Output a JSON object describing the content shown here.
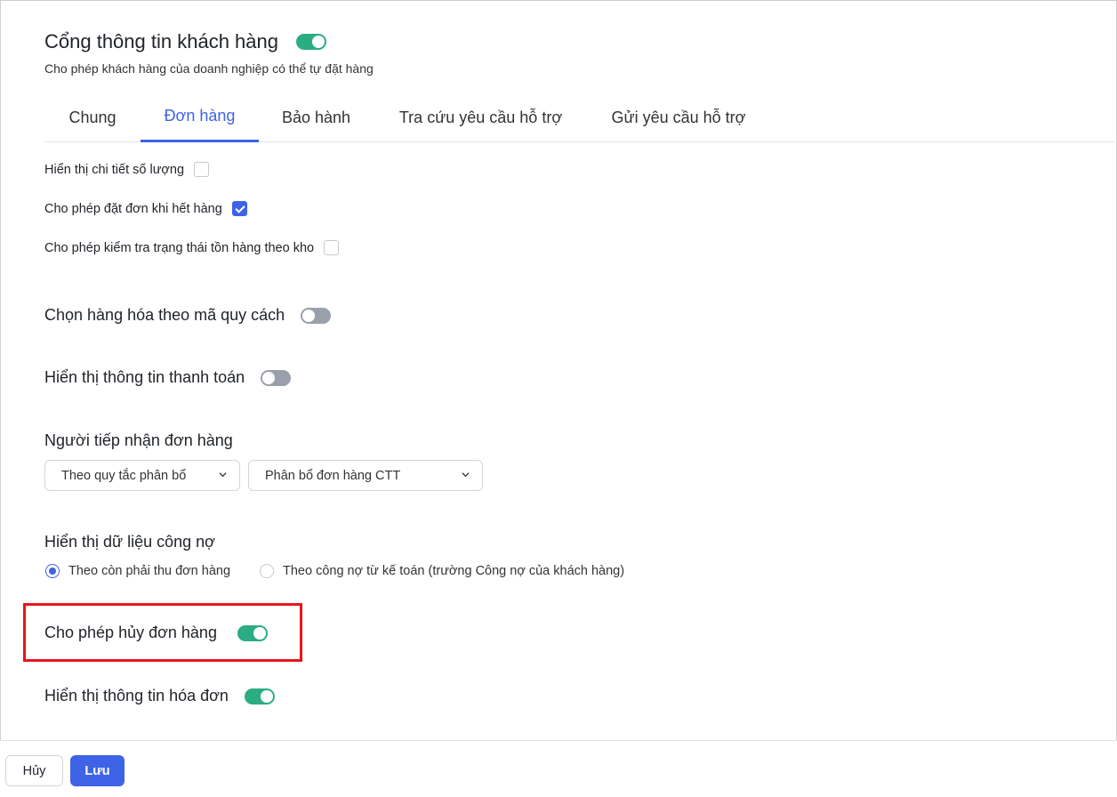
{
  "header": {
    "title": "Cổng thông tin khách hàng",
    "subtitle": "Cho phép khách hàng của doanh nghiệp có thể tự đặt hàng",
    "enabled": true
  },
  "tabs": [
    {
      "label": "Chung",
      "active": false
    },
    {
      "label": "Đơn hàng",
      "active": true
    },
    {
      "label": "Bảo hành",
      "active": false
    },
    {
      "label": "Tra cứu yêu cầu hỗ trợ",
      "active": false
    },
    {
      "label": "Gửi yêu cầu hỗ trợ",
      "active": false
    }
  ],
  "checkboxes": [
    {
      "label": "Hiển thị chi tiết số lượng",
      "checked": false
    },
    {
      "label": "Cho phép đặt đơn khi hết hàng",
      "checked": true
    },
    {
      "label": "Cho phép kiểm tra trạng thái tồn hàng theo kho",
      "checked": false
    }
  ],
  "settings": {
    "select_by_spec": {
      "label": "Chọn hàng hóa theo mã quy cách",
      "enabled": false
    },
    "show_payment_info": {
      "label": "Hiển thị thông tin thanh toán",
      "enabled": false
    },
    "allow_cancel_order": {
      "label": "Cho phép hủy đơn hàng",
      "enabled": true
    },
    "show_invoice_info": {
      "label": "Hiển thị thông tin hóa đơn",
      "enabled": true
    }
  },
  "order_receiver": {
    "label": "Người tiếp nhận đơn hàng",
    "rule_select": "Theo quy tắc phân bổ",
    "allocation_select": "Phân bổ đơn hàng CTT"
  },
  "debt_data": {
    "label": "Hiển thị dữ liệu công nợ",
    "options": [
      {
        "label": "Theo còn phải thu đơn hàng",
        "selected": true
      },
      {
        "label": "Theo công nợ từ kế toán (trường Công nợ của khách hàng)",
        "selected": false
      }
    ]
  },
  "footer": {
    "cancel_label": "Hủy",
    "save_label": "Lưu"
  },
  "colors": {
    "accent": "#3e63e6",
    "toggle_on": "#2bac82",
    "toggle_off": "#9aa0ab",
    "highlight": "#e5161b"
  }
}
